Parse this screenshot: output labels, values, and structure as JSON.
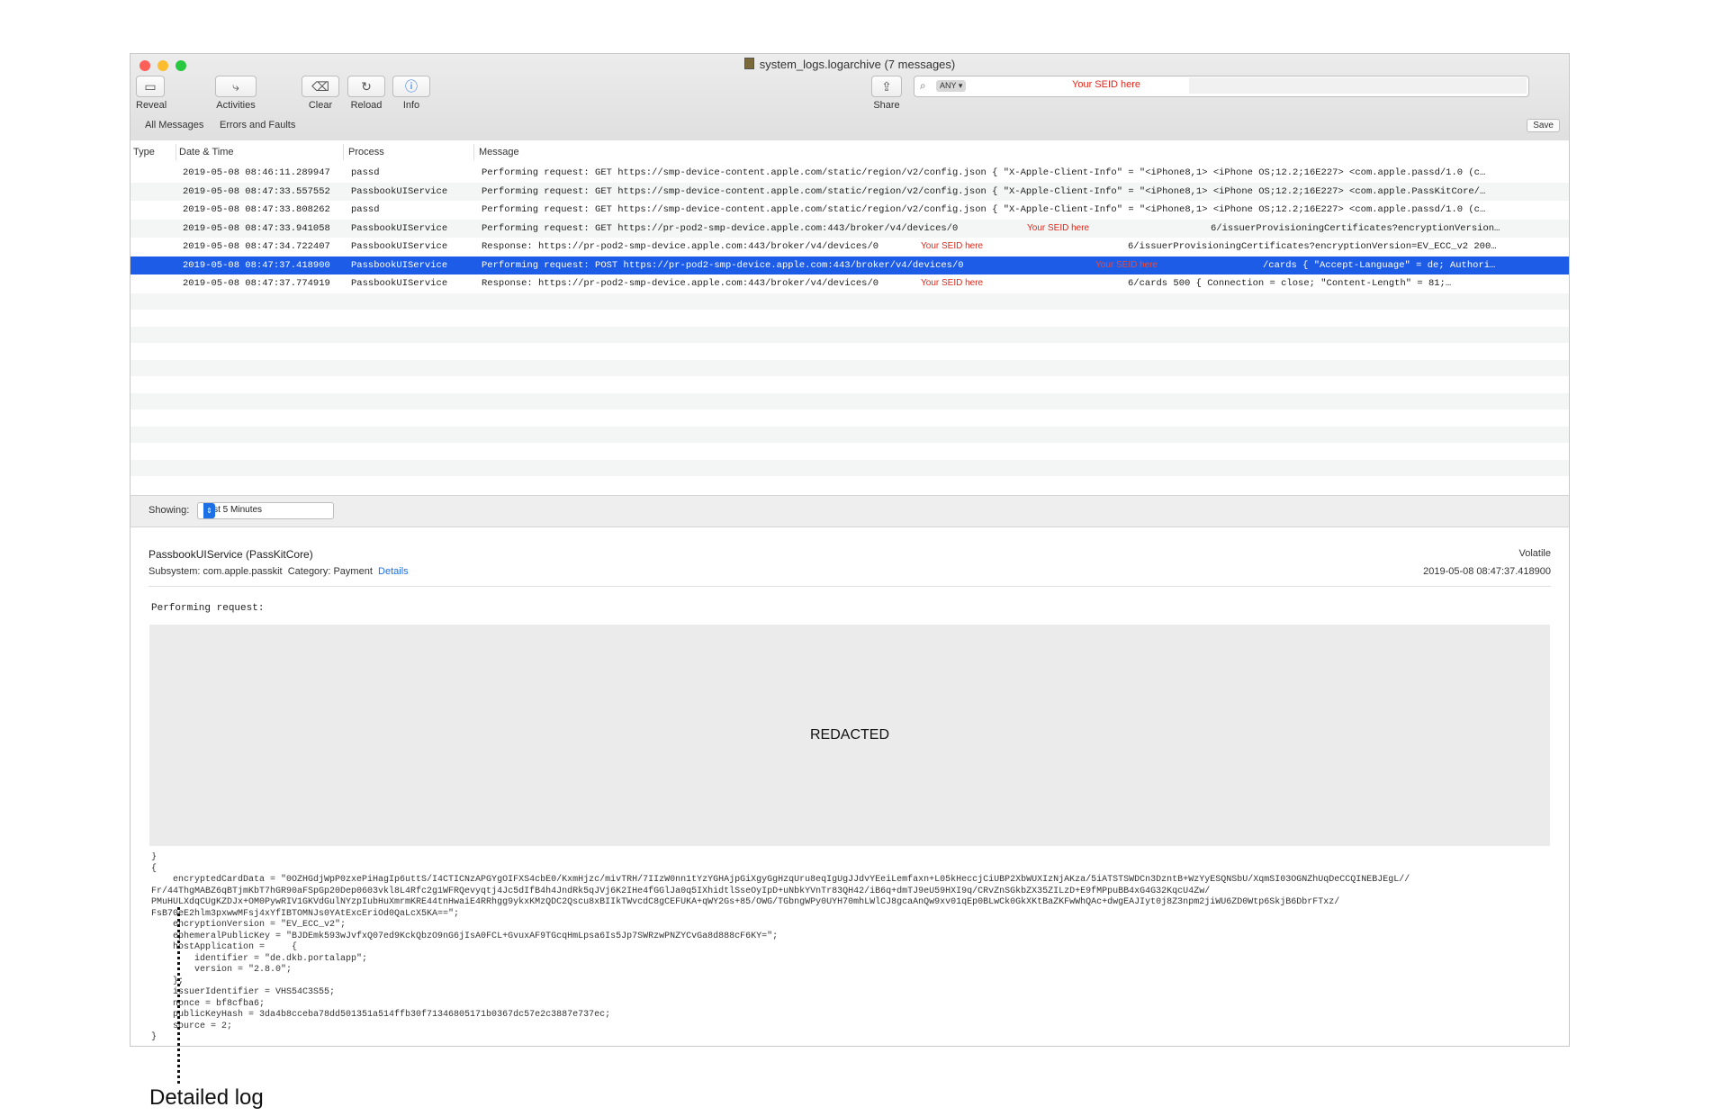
{
  "window": {
    "title": "system_logs.logarchive (7 messages)",
    "light_colors": [
      "#fe5f57",
      "#febc2e",
      "#28c840"
    ]
  },
  "toolbar": {
    "reveal": "Reveal",
    "activities": "Activities",
    "clear": "Clear",
    "reload": "Reload",
    "info": "Info",
    "share": "Share"
  },
  "search": {
    "scope": "ANY",
    "value": "Your SEID here"
  },
  "filters": {
    "all_messages": "All Messages",
    "errors_faults": "Errors and Faults",
    "save": "Save"
  },
  "columns": {
    "type": "Type",
    "date_time": "Date & Time",
    "process": "Process",
    "message": "Message"
  },
  "rows": [
    {
      "date": "2019-05-08 08:46:11.289947",
      "process": "passd",
      "message": "Performing request: GET https://smp-device-content.apple.com/static/region/v2/config.json {     \"X-Apple-Client-Info\" = \"<iPhone8,1> <iPhone OS;12.2;16E227> <com.apple.passd/1.0 (c…",
      "mask": "",
      "tail": ""
    },
    {
      "date": "2019-05-08 08:47:33.557552",
      "process": "PassbookUIService",
      "message": "Performing request: GET https://smp-device-content.apple.com/static/region/v2/config.json {     \"X-Apple-Client-Info\" = \"<iPhone8,1> <iPhone OS;12.2;16E227> <com.apple.PassKitCore/…",
      "mask": "",
      "tail": ""
    },
    {
      "date": "2019-05-08 08:47:33.808262",
      "process": "passd",
      "message": "Performing request: GET https://smp-device-content.apple.com/static/region/v2/config.json {     \"X-Apple-Client-Info\" = \"<iPhone8,1> <iPhone OS;12.2;16E227> <com.apple.passd/1.0 (c…",
      "mask": "",
      "tail": ""
    },
    {
      "date": "2019-05-08 08:47:33.941058",
      "process": "PassbookUIService",
      "message": "Performing request: GET https://pr-pod2-smp-device.apple.com:443/broker/v4/devices/0",
      "mask": "Your SEID here",
      "tail": "6/issuerProvisioningCertificates?encryptionVersion…"
    },
    {
      "date": "2019-05-08 08:47:34.722407",
      "process": "PassbookUIService",
      "message": "Response: https://pr-pod2-smp-device.apple.com:443/broker/v4/devices/0",
      "mask": "Your SEID here",
      "tail": "6/issuerProvisioningCertificates?encryptionVersion=EV_ECC_v2 200…"
    },
    {
      "date": "2019-05-08 08:47:37.418900",
      "process": "PassbookUIService",
      "message": "Performing request: POST https://pr-pod2-smp-device.apple.com:443/broker/v4/devices/0",
      "mask": "Your SEID here",
      "tail": "/cards {     \"Accept-Language\" = de;     Authori…"
    },
    {
      "date": "2019-05-08 08:47:37.774919",
      "process": "PassbookUIService",
      "message": "Response: https://pr-pod2-smp-device.apple.com:443/broker/v4/devices/0",
      "mask": "Your SEID here",
      "tail": "6/cards 500 {     Connection = close;     \"Content-Length\" = 81;…"
    }
  ],
  "showing": {
    "label": "Showing:",
    "value": "Last 5 Minutes"
  },
  "detail": {
    "process": "PassbookUIService (PassKitCore)",
    "subsystem_label": "Subsystem:",
    "subsystem": "com.apple.passkit",
    "category_label": "Category:",
    "category": "Payment",
    "details_link": "Details",
    "volatile": "Volatile",
    "timestamp": "2019-05-08 08:47:37.418900",
    "request_text": "Performing request:",
    "redacted": "REDACTED",
    "code": "}\n{\n    encryptedCardData = \"0OZHGdjWpP0zxePiHagIp6uttS/I4CTICNzAPGYgOIFXS4cbE0/KxmHjzc/mivTRH/7IIzW0nn1tYzYGHAjpGiXgyGgHzqUru8eqIgUgJJdvYEeiLemfaxn+L05kHeccjCiUBP2XbWUXIzNjAKza/5iATSTSWDCn3DzntB+WzYyESQNSbU/XqmSI03OGNZhUqDeCCQINEBJEgL//\nFr/44ThgMABZ6qBTjmKbT7hGR90aFSpGp20Dep0603vkl8L4Rfc2g1WFRQevyqtj4Jc5dIfB4h4JndRk5qJVj6K2IHe4fGGlJa0q5IXhidtlSseOyIpD+uNbkYVnTr83QH42/iB6q+dmTJ9eU59HXI9q/CRvZnSGkbZX35ZILzD+E9fMPpuBB4xG4G32KqcU4Zw/\nPMuHULXdqCUgKZDJx+OM0PywRIV1GKVdGulNYzpIubHuXmrmKRE44tnHwaiE4RRhgg9ykxKMzQDC2Qscu8xBIIkTWvcdC8gCEFUKA+qWY2Gs+85/OWG/TGbngWPy0UYH70mhLWlCJ8gcaAnQw9xv01qEp0BLwCk0GkXKtBaZKFwWhQAc+dwgEAJIyt0j8Z3npm2jiWU6ZD0Wtp6SkjB6DbrFTxz/\nFsB70eE2hlm3pxwwMFsj4xYfIBTOMNJs0YAtExcEriOd0QaLcX5KA==\";\n    encryptionVersion = \"EV_ECC_v2\";\n    ephemeralPublicKey = \"BJDEmk593wJvfxQ07ed9KckQbzO9nG6jIsA0FCL+GvuxAF9TGcqHmLpsa6Is5Jp7SWRzwPNZYCvGa8d888cF6KY=\";\n    hostApplication =     {\n        identifier = \"de.dkb.portalapp\";\n        version = \"2.8.0\";\n    };\n    issuerIdentifier = VHS54C3S55;\n    nonce = bf8cfba6;\n    publicKeyHash = 3da4b8cceba78dd501351a514ffb30f71346805171b0367dc57e2c3887e737ec;\n    source = 2;\n}"
  },
  "annotation": {
    "callout": "Detailed log"
  }
}
